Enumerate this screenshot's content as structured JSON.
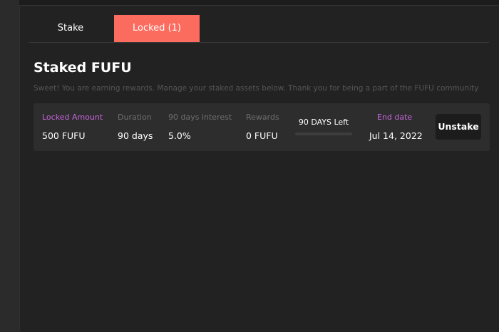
{
  "tabs": {
    "stake_label": "Stake",
    "locked_label": "Locked (1)",
    "active_color": "#fc6c5e"
  },
  "header": {
    "title": "Staked FUFU",
    "subtitle": "Sweet! You are earning rewards. Manage your staked assets below. Thank you for being a part of the FUFU community"
  },
  "stake": {
    "locked_amount_label": "Locked Amount",
    "locked_amount": "500 FUFU",
    "duration_label": "Duration",
    "duration": "90 days",
    "interest_label": "90 days interest",
    "interest": "5.0%",
    "rewards_label": "Rewards",
    "rewards": "0 FUFU",
    "days_left": "90 DAYS Left",
    "progress_percent": 0,
    "end_date_label": "End date",
    "end_date": "Jul 14, 2022",
    "unstake_label": "Unstake"
  },
  "colors": {
    "accent_label": "#c464d9",
    "background": "#222222",
    "card": "#2d2d2d"
  }
}
